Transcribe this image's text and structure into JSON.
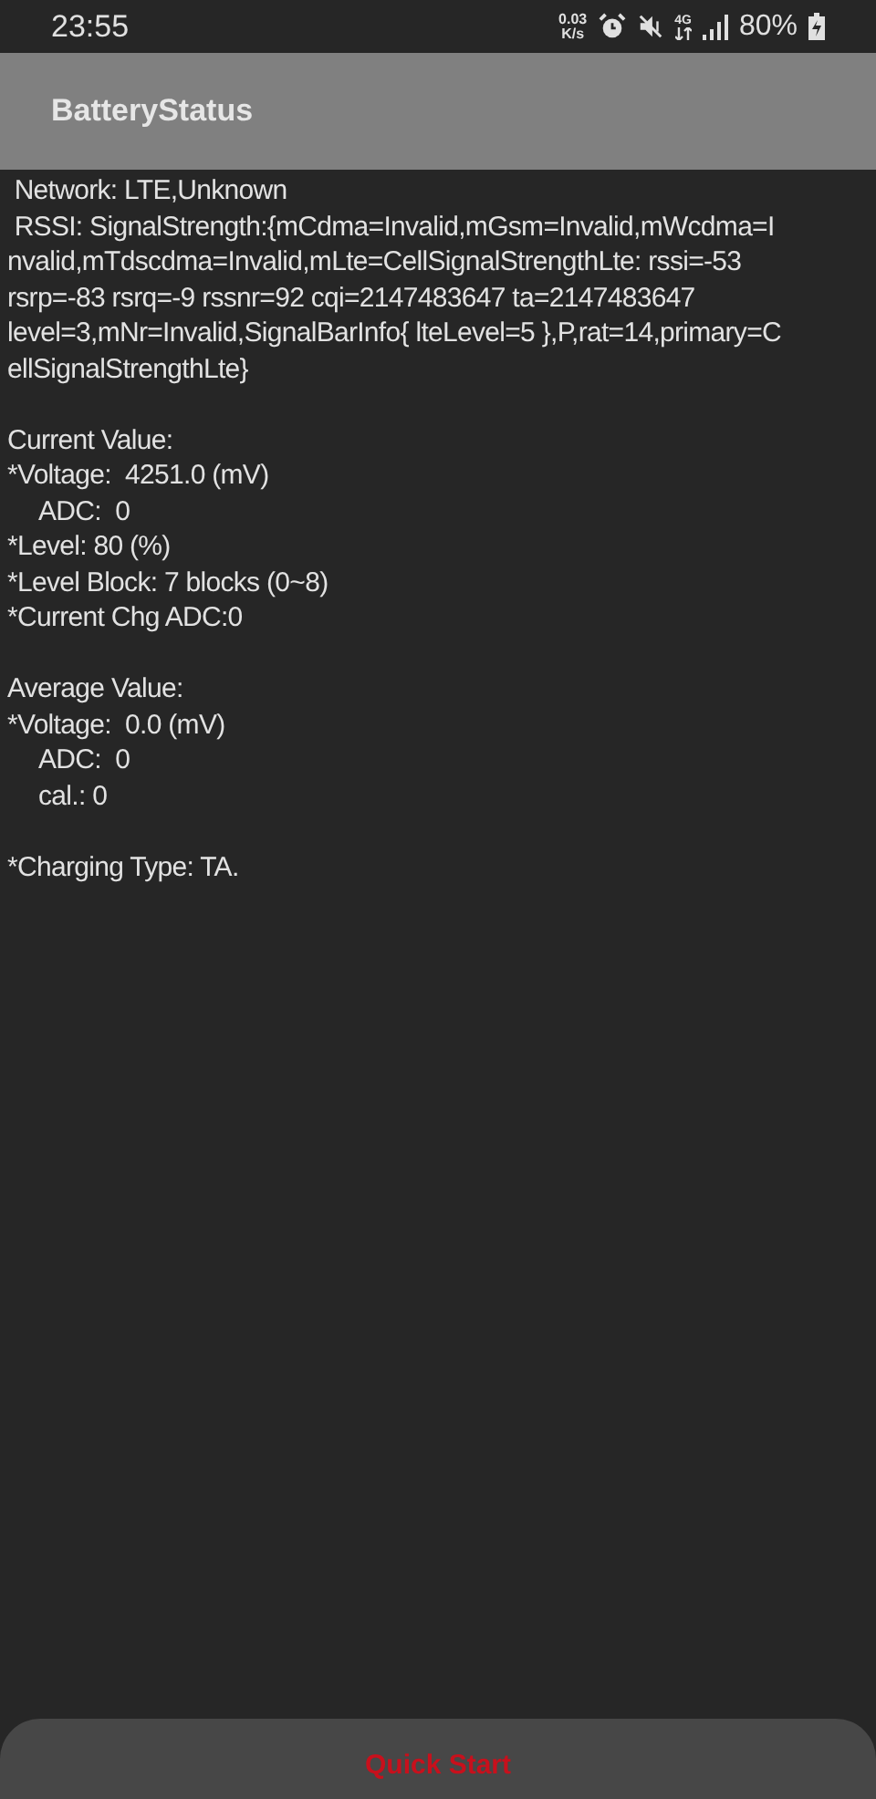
{
  "status_bar": {
    "time": "23:55",
    "net_speed": "0.03",
    "net_unit": "K/s",
    "network": "4G",
    "battery": "80%"
  },
  "app_bar": {
    "title": "BatteryStatus"
  },
  "sections": [
    {
      "lines": [
        {
          "kind": "plain",
          "text": " Network: LTE,Unknown"
        },
        {
          "kind": "plain",
          "text": " RSSI: SignalStrength:{mCdma=Invalid,mGsm=Invalid,mWcdma=I"
        },
        {
          "kind": "plain",
          "text": "nvalid,mTdscdma=Invalid,mLte=CellSignalStrengthLte: rssi=-53"
        },
        {
          "kind": "plain",
          "text": "rsrp=-83 rsrq=-9 rssnr=92 cqi=2147483647 ta=2147483647"
        },
        {
          "kind": "plain",
          "text": "level=3,mNr=Invalid,SignalBarInfo{ lteLevel=5 },P,rat=14,primary=C"
        },
        {
          "kind": "plain",
          "text": "ellSignalStrengthLte}"
        }
      ]
    },
    {
      "lines": [
        {
          "kind": "plain",
          "text": "Current Value:"
        },
        {
          "kind": "plain",
          "text": "*Voltage:  4251.0 (mV)"
        },
        {
          "kind": "indent",
          "text": "ADC:  0"
        },
        {
          "kind": "plain",
          "text": "*Level: 80 (%)"
        },
        {
          "kind": "plain",
          "text": "*Level Block: 7 blocks (0~8)"
        },
        {
          "kind": "plain",
          "text": "*Current Chg ADC:0"
        }
      ]
    },
    {
      "lines": [
        {
          "kind": "plain",
          "text": "Average Value:"
        },
        {
          "kind": "plain",
          "text": "*Voltage:  0.0 (mV)"
        },
        {
          "kind": "indent",
          "text": "ADC:  0"
        },
        {
          "kind": "indent",
          "text": "cal.: 0"
        }
      ]
    },
    {
      "lines": [
        {
          "kind": "plain",
          "text": "*Charging Type: TA."
        }
      ]
    }
  ],
  "button": {
    "label": "Quick Start"
  }
}
